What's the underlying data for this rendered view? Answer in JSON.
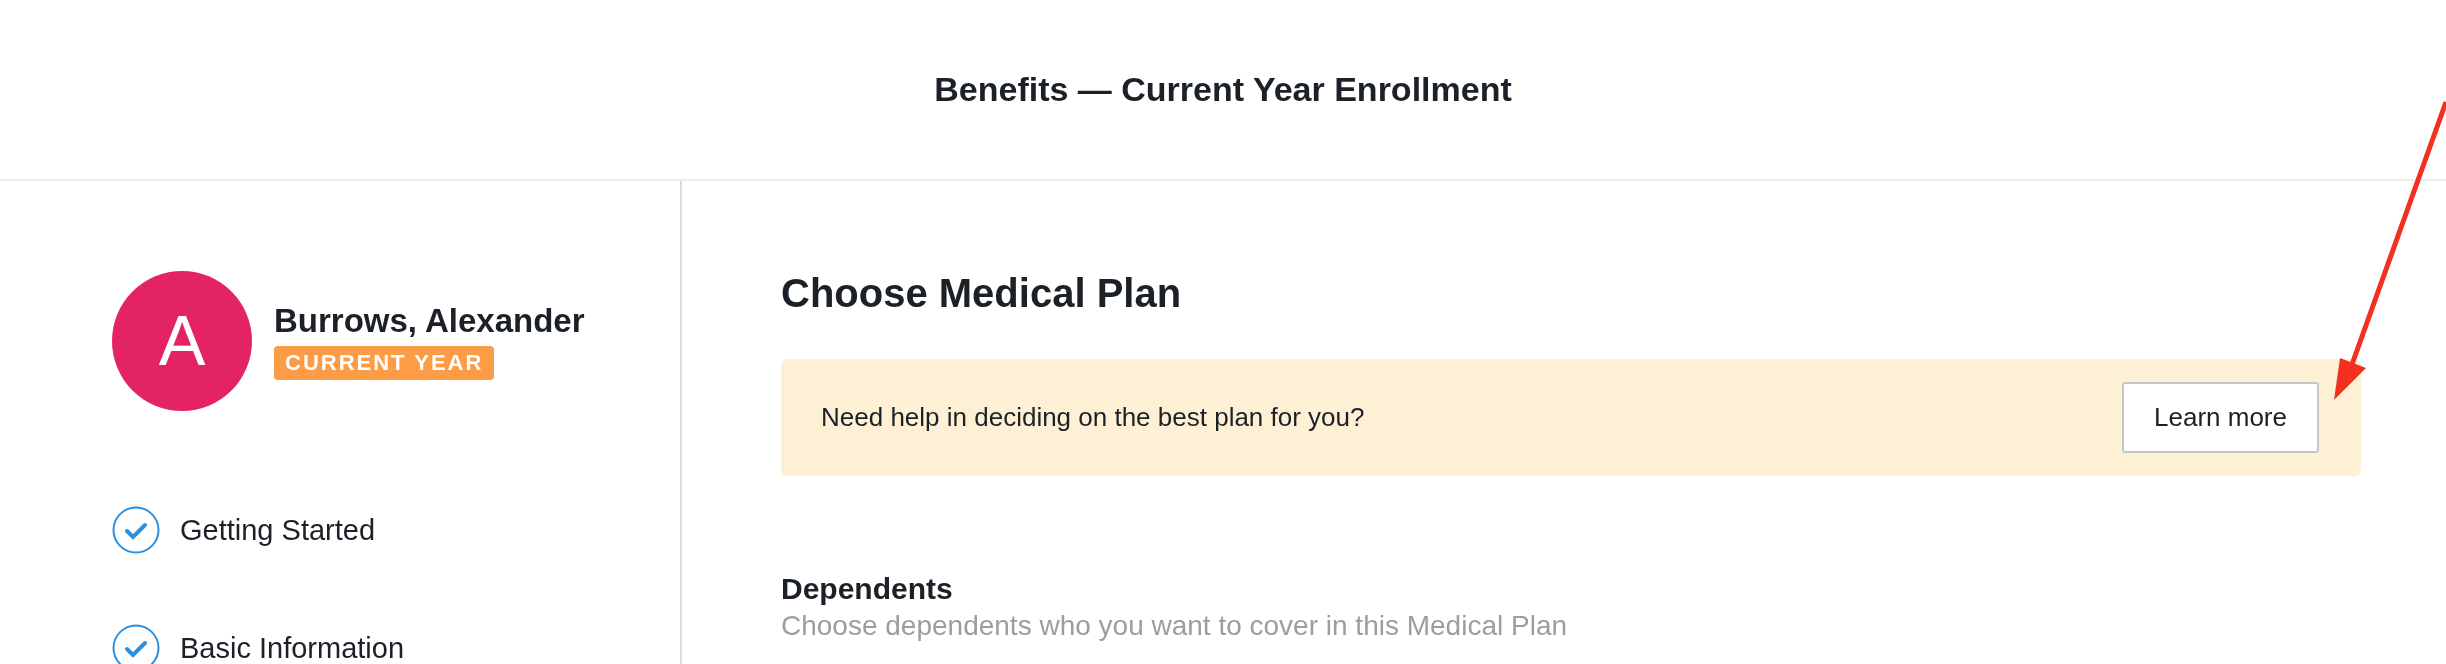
{
  "header": {
    "title": "Benefits — Current Year Enrollment"
  },
  "profile": {
    "initial": "A",
    "name": "Burrows, Alexander",
    "badge": "CURRENT YEAR"
  },
  "steps": [
    {
      "label": "Getting Started",
      "checked": true
    },
    {
      "label": "Basic Information",
      "checked": true
    }
  ],
  "main": {
    "heading": "Choose Medical Plan",
    "banner": {
      "text": "Need help in deciding on the best plan for you?",
      "button": "Learn more"
    },
    "section": {
      "title": "Dependents",
      "subtitle": "Choose dependents who you want to cover in this Medical Plan"
    }
  }
}
